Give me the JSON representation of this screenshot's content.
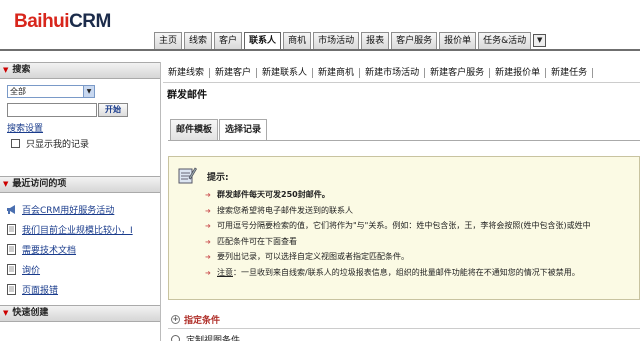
{
  "brand": {
    "name_red": "Baihui",
    "name_dark": "CRM"
  },
  "tabs": [
    "主页",
    "线索",
    "客户",
    "联系人",
    "商机",
    "市场活动",
    "报表",
    "客户服务",
    "报价单",
    "任务&活动"
  ],
  "active_tab": "联系人",
  "sidebar": {
    "search": {
      "title": "搜索",
      "scope_value": "全部",
      "input_value": "",
      "go_label": "开始",
      "settings_label": "搜索设置",
      "own_only_label": "只显示我的记录"
    },
    "recent": {
      "title": "最近访问的项",
      "items": [
        {
          "label": "百会CRM用好服务活动",
          "icon": "megaphone-icon"
        },
        {
          "label": "我们目前企业规模比较小，I",
          "icon": "document-icon"
        },
        {
          "label": "需要技术文档",
          "icon": "document-icon"
        },
        {
          "label": "询价",
          "icon": "document-icon"
        },
        {
          "label": "页面报错",
          "icon": "document-icon"
        }
      ]
    },
    "quick_create": {
      "title": "快速创建"
    }
  },
  "subnav": [
    "新建线索",
    "新建客户",
    "新建联系人",
    "新建商机",
    "新建市场活动",
    "新建客户服务",
    "新建报价单",
    "新建任务"
  ],
  "page_title": "群发邮件",
  "content_tabs": [
    "邮件模板",
    "选择记录"
  ],
  "active_content_tab": "选择记录",
  "tips": {
    "title": "提示:",
    "items": [
      {
        "text": "群发邮件每天可发250封邮件。",
        "bold": true
      },
      {
        "text": "搜索您希望将电子邮件发送到的联系人"
      },
      {
        "text": "可用逗号分隔要检索的值，它们将作为\"与\"关系。例如：姓中包含张，王，李将会按照(姓中包含张)或姓中"
      },
      {
        "text": "匹配条件可在下面查看"
      },
      {
        "text": "要列出记录，可以选择自定义视图或者指定匹配条件。"
      },
      {
        "prefix": "注意",
        "text": "：一旦收到来自线索/联系人的垃圾报表信息，组织的批量邮件功能将在不通知您的情况下被禁用。"
      }
    ]
  },
  "conditions": {
    "title": "指定条件",
    "custom_view_label": "定制视图条件"
  },
  "colors": {
    "brand_red": "#d8261c",
    "tips_bg": "#fbfae4",
    "link_blue": "#1a3c8c"
  }
}
